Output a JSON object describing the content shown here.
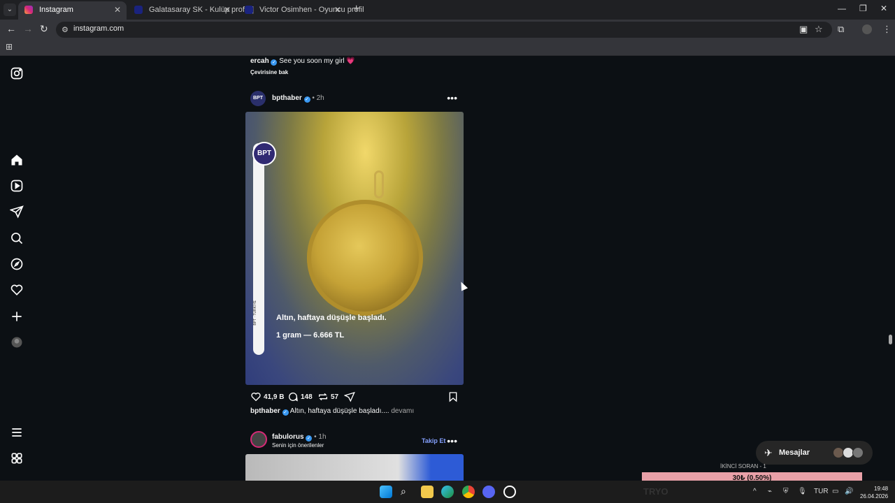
{
  "browser": {
    "tabs": [
      {
        "title": "Instagram",
        "active": true
      },
      {
        "title": "Galatasaray SK - Kulüp profili |",
        "active": false
      },
      {
        "title": "Victor Osimhen - Oyuncu profil",
        "active": false
      }
    ],
    "url": "instagram.com"
  },
  "feed": {
    "prev_caption": {
      "user": "ercah",
      "text": "See you soon my girl 💗",
      "translate": "Çevirisine bak"
    },
    "post": {
      "user": "bpthaber",
      "time": "• 2h",
      "avatar_text": "BPT",
      "image_title": "Altın, haftaya düşüşle başladı.",
      "image_subtitle": "1 gram — 6.666 TL",
      "strip_text": "BPT · TÜRKİYE",
      "likes": "41,9 B",
      "comments": "148",
      "reposts": "57",
      "caption_user": "bpthaber",
      "caption_text": "Altın, haftaya düşüşle başladı....",
      "caption_more": "devamı"
    },
    "next_post": {
      "user": "fabulorus",
      "time": "• 1h",
      "subtitle": "Senin için önerilenler",
      "follow": "Takip Et"
    }
  },
  "messages_button": "Mesajlar",
  "overlay": {
    "top": "İKİNCİ SORAN - 1",
    "ticker": "30₺ (0.50%)",
    "bottom": "TRYO"
  },
  "taskbar": {
    "lang": "TUR",
    "time": "19:48",
    "date": "26.04.2026"
  },
  "colors": {
    "accent": "#3897f0",
    "follow": "#85a1ff",
    "ticker": "#e8a0a8"
  }
}
